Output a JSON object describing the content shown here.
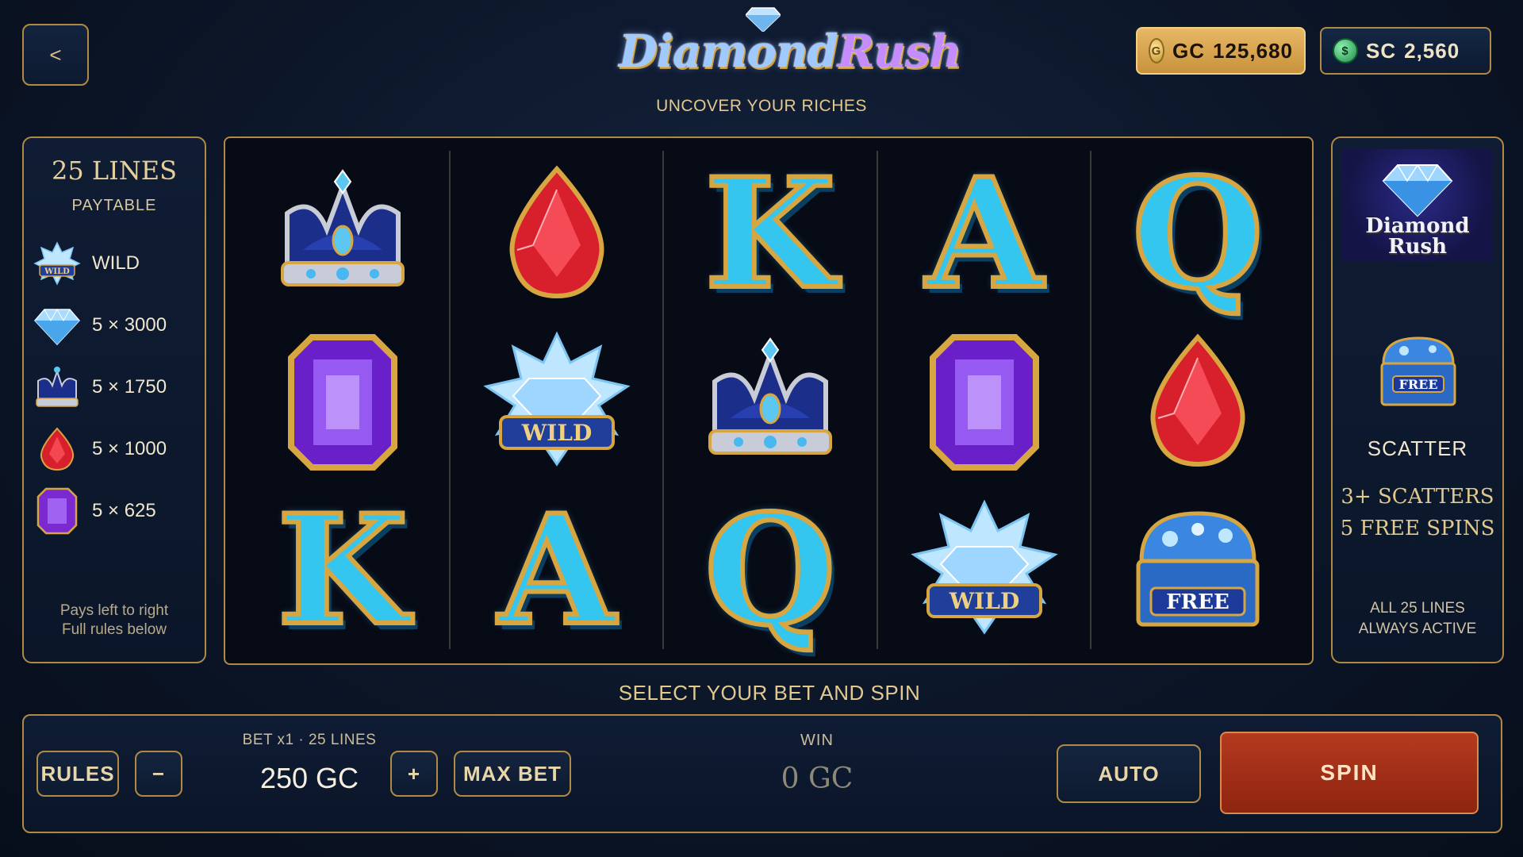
{
  "header": {
    "back_label": "<",
    "logo_word1": "Diamond",
    "logo_word2": "Rush",
    "tagline": "UNCOVER YOUR RICHES"
  },
  "balances": {
    "gc_label": "GC",
    "gc_value": "125,680",
    "sc_label": "SC",
    "sc_value": "2,560",
    "gc_icon": "gold-coin-icon",
    "sc_icon": "green-coin-icon"
  },
  "paytable": {
    "lines_title": "25 LINES",
    "subtitle": "PAYTABLE",
    "rows": [
      {
        "symbol": "wild",
        "label": "WILD"
      },
      {
        "symbol": "diamond",
        "label": "5 × 3000"
      },
      {
        "symbol": "crown",
        "label": "5 × 1750"
      },
      {
        "symbol": "ruby",
        "label": "5 × 1000"
      },
      {
        "symbol": "amethyst",
        "label": "5 × 625"
      }
    ],
    "footer_line1": "Pays left to right",
    "footer_line2": "Full rules below"
  },
  "reels": [
    [
      "crown",
      "amethyst",
      "K"
    ],
    [
      "ruby",
      "wild",
      "A"
    ],
    [
      "K",
      "crown",
      "Q"
    ],
    [
      "A",
      "amethyst",
      "wild"
    ],
    [
      "Q",
      "ruby",
      "free"
    ]
  ],
  "symbol_text": {
    "wild_banner": "WILD",
    "free_banner": "FREE"
  },
  "right_panel": {
    "logo_line1": "Diamond",
    "logo_line2": "Rush",
    "scatter_label": "SCATTER",
    "rule_line1": "3+ SCATTERS",
    "rule_line2": "5 FREE SPINS",
    "footer_line1": "ALL 25 LINES",
    "footer_line2": "ALWAYS ACTIVE"
  },
  "instruction": "SELECT YOUR BET AND SPIN",
  "controls": {
    "rules_label": "RULES",
    "minus_label": "−",
    "bet_label": "BET x1 · 25 LINES",
    "bet_value": "250 GC",
    "plus_label": "+",
    "max_bet_label": "MAX BET",
    "win_label": "WIN",
    "win_value": "0 GC",
    "auto_label": "AUTO",
    "spin_label": "SPIN"
  },
  "colors": {
    "gold_border": "#b08a44",
    "gc_pill": "#e0ad5c",
    "spin_red": "#a8301a",
    "ruby": "#d8202c",
    "amethyst": "#8a3ad8",
    "ice_blue": "#34c6ee"
  }
}
